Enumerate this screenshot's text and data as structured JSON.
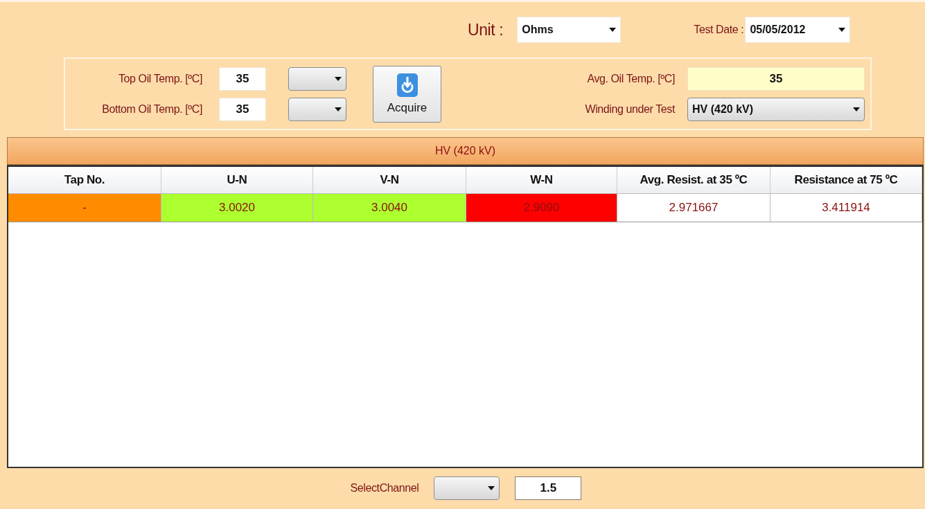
{
  "unit": {
    "label": "Unit :",
    "value": "Ohms"
  },
  "test_date": {
    "label": "Test Date :",
    "value": "05/05/2012"
  },
  "temperatures": [
    {
      "label": "Top Oil Temp. [ºC]",
      "value": "35"
    },
    {
      "label": "Bottom Oil Temp. [ºC]",
      "value": "35"
    }
  ],
  "acquire_button": {
    "label": "Acquire"
  },
  "avg_oil_temp": {
    "label": "Avg. Oil Temp. [ºC]",
    "value": "35"
  },
  "winding": {
    "label": "Winding under Test",
    "value": "HV (420 kV)"
  },
  "grid": {
    "title": "HV (420 kV)",
    "columns": [
      "Tap No.",
      "U-N",
      "V-N",
      "W-N",
      "Avg. Resist. at 35 ºC",
      "Resistance at 75 ºC"
    ],
    "rows": [
      {
        "cells": [
          {
            "text": "-",
            "color": "#ff8c00"
          },
          {
            "text": "3.0020",
            "color": "#adff2f"
          },
          {
            "text": "3.0040",
            "color": "#adff2f"
          },
          {
            "text": "2.9090",
            "color": "#ff0000"
          },
          {
            "text": "2.971667",
            "color": "#ffffff"
          },
          {
            "text": "3.411914",
            "color": "#ffffff"
          }
        ]
      }
    ]
  },
  "select_channel": {
    "label": "SelectChannel",
    "value": "1.5"
  }
}
